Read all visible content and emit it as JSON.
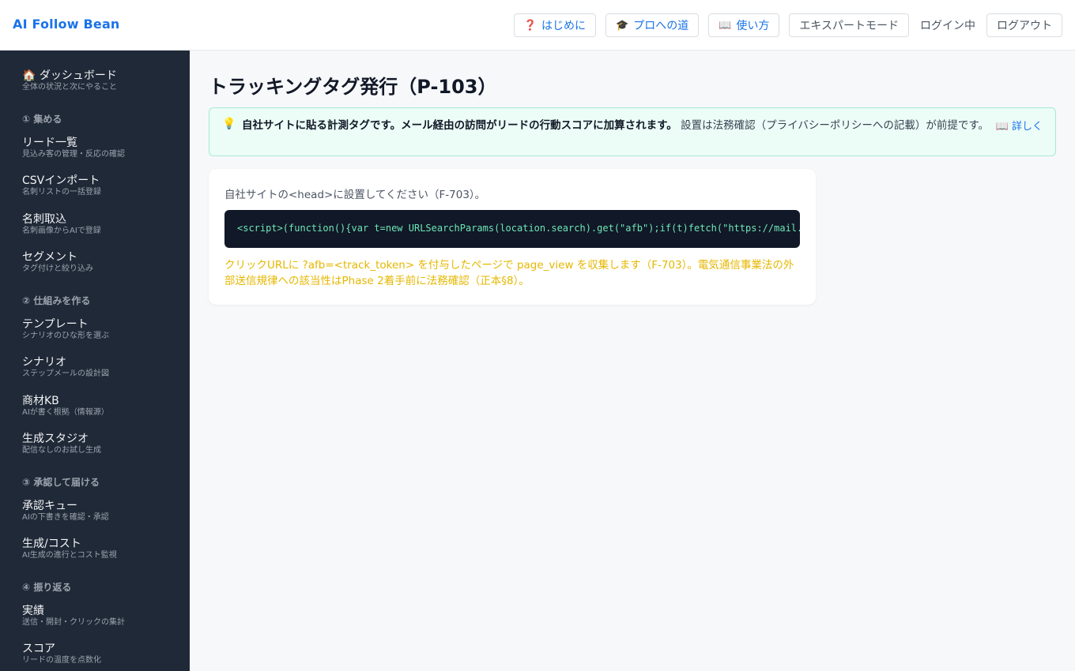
{
  "header": {
    "brand": "AI Follow Bean",
    "buttons": [
      {
        "icon": "question-icon",
        "glyph": "❓",
        "label": "はじめに"
      },
      {
        "icon": "graduation-cap-icon",
        "glyph": "🎓",
        "label": "プロへの道"
      },
      {
        "icon": "book-icon",
        "glyph": "📖",
        "label": "使い方"
      }
    ],
    "expert_mode": "エキスパートモード",
    "login_status": "ログイン中",
    "logout": "ログアウト"
  },
  "sidebar": {
    "dashboard": {
      "icon": "home-icon",
      "glyph": "🏠",
      "label": "ダッシュボード",
      "sub": "全体の状況と次にやること"
    },
    "sections": [
      "① 集める",
      "② 仕組みを作る",
      "③ 承認して届ける",
      "④ 振り返る"
    ],
    "items": [
      {
        "label": "リード一覧",
        "sub": "見込み客の管理・反応の確認"
      },
      {
        "label": "CSVインポート",
        "sub": "名刺リストの一括登録"
      },
      {
        "label": "名刺取込",
        "sub": "名刺画像からAIで登録"
      },
      {
        "label": "セグメント",
        "sub": "タグ付けと絞り込み"
      },
      {
        "label": "テンプレート",
        "sub": "シナリオのひな形を選ぶ"
      },
      {
        "label": "シナリオ",
        "sub": "ステップメールの設計図"
      },
      {
        "label": "商材KB",
        "sub": "AIが書く根拠（情報源）"
      },
      {
        "label": "生成スタジオ",
        "sub": "配信なしのお試し生成"
      },
      {
        "label": "承認キュー",
        "sub": "AIの下書きを確認・承認"
      },
      {
        "label": "生成/コスト",
        "sub": "AI生成の進行とコスト監視"
      },
      {
        "label": "実績",
        "sub": "送信・開封・クリックの集計"
      },
      {
        "label": "スコア",
        "sub": "リードの温度を点数化"
      }
    ]
  },
  "main": {
    "title": "トラッキングタグ発行（P-103）",
    "notice": {
      "icon": "lightbulb-icon",
      "glyph": "💡",
      "bold": "自社サイトに貼る計測タグです。メール経由の訪問がリードの行動スコアに加算されます。",
      "rest": " 設置は法務確認（プライバシーポリシーへの記載）が前提です。",
      "more_glyph": "📖",
      "more": "詳しく"
    },
    "card": {
      "intro": "自社サイトの<head>に設置してください（F-703）。",
      "code": "<script>(function(){var t=new URLSearchParams(location.search).get(\"afb\");if(t)fetch(\"https://mail.",
      "warning": "クリックURLに ?afb=<track_token> を付与したページで page_view を収集します（F-703）。電気通信事業法の外部送信規律への該当性はPhase 2着手前に法務確認（正本§8）。"
    }
  },
  "colors": {
    "brand": "#1a73e8",
    "sidebar_bg": "#1f2937",
    "notice_bg": "#ecfdf7",
    "code_bg": "#111827",
    "code_text": "#6ee7b7",
    "warning_text": "#e5b700"
  }
}
